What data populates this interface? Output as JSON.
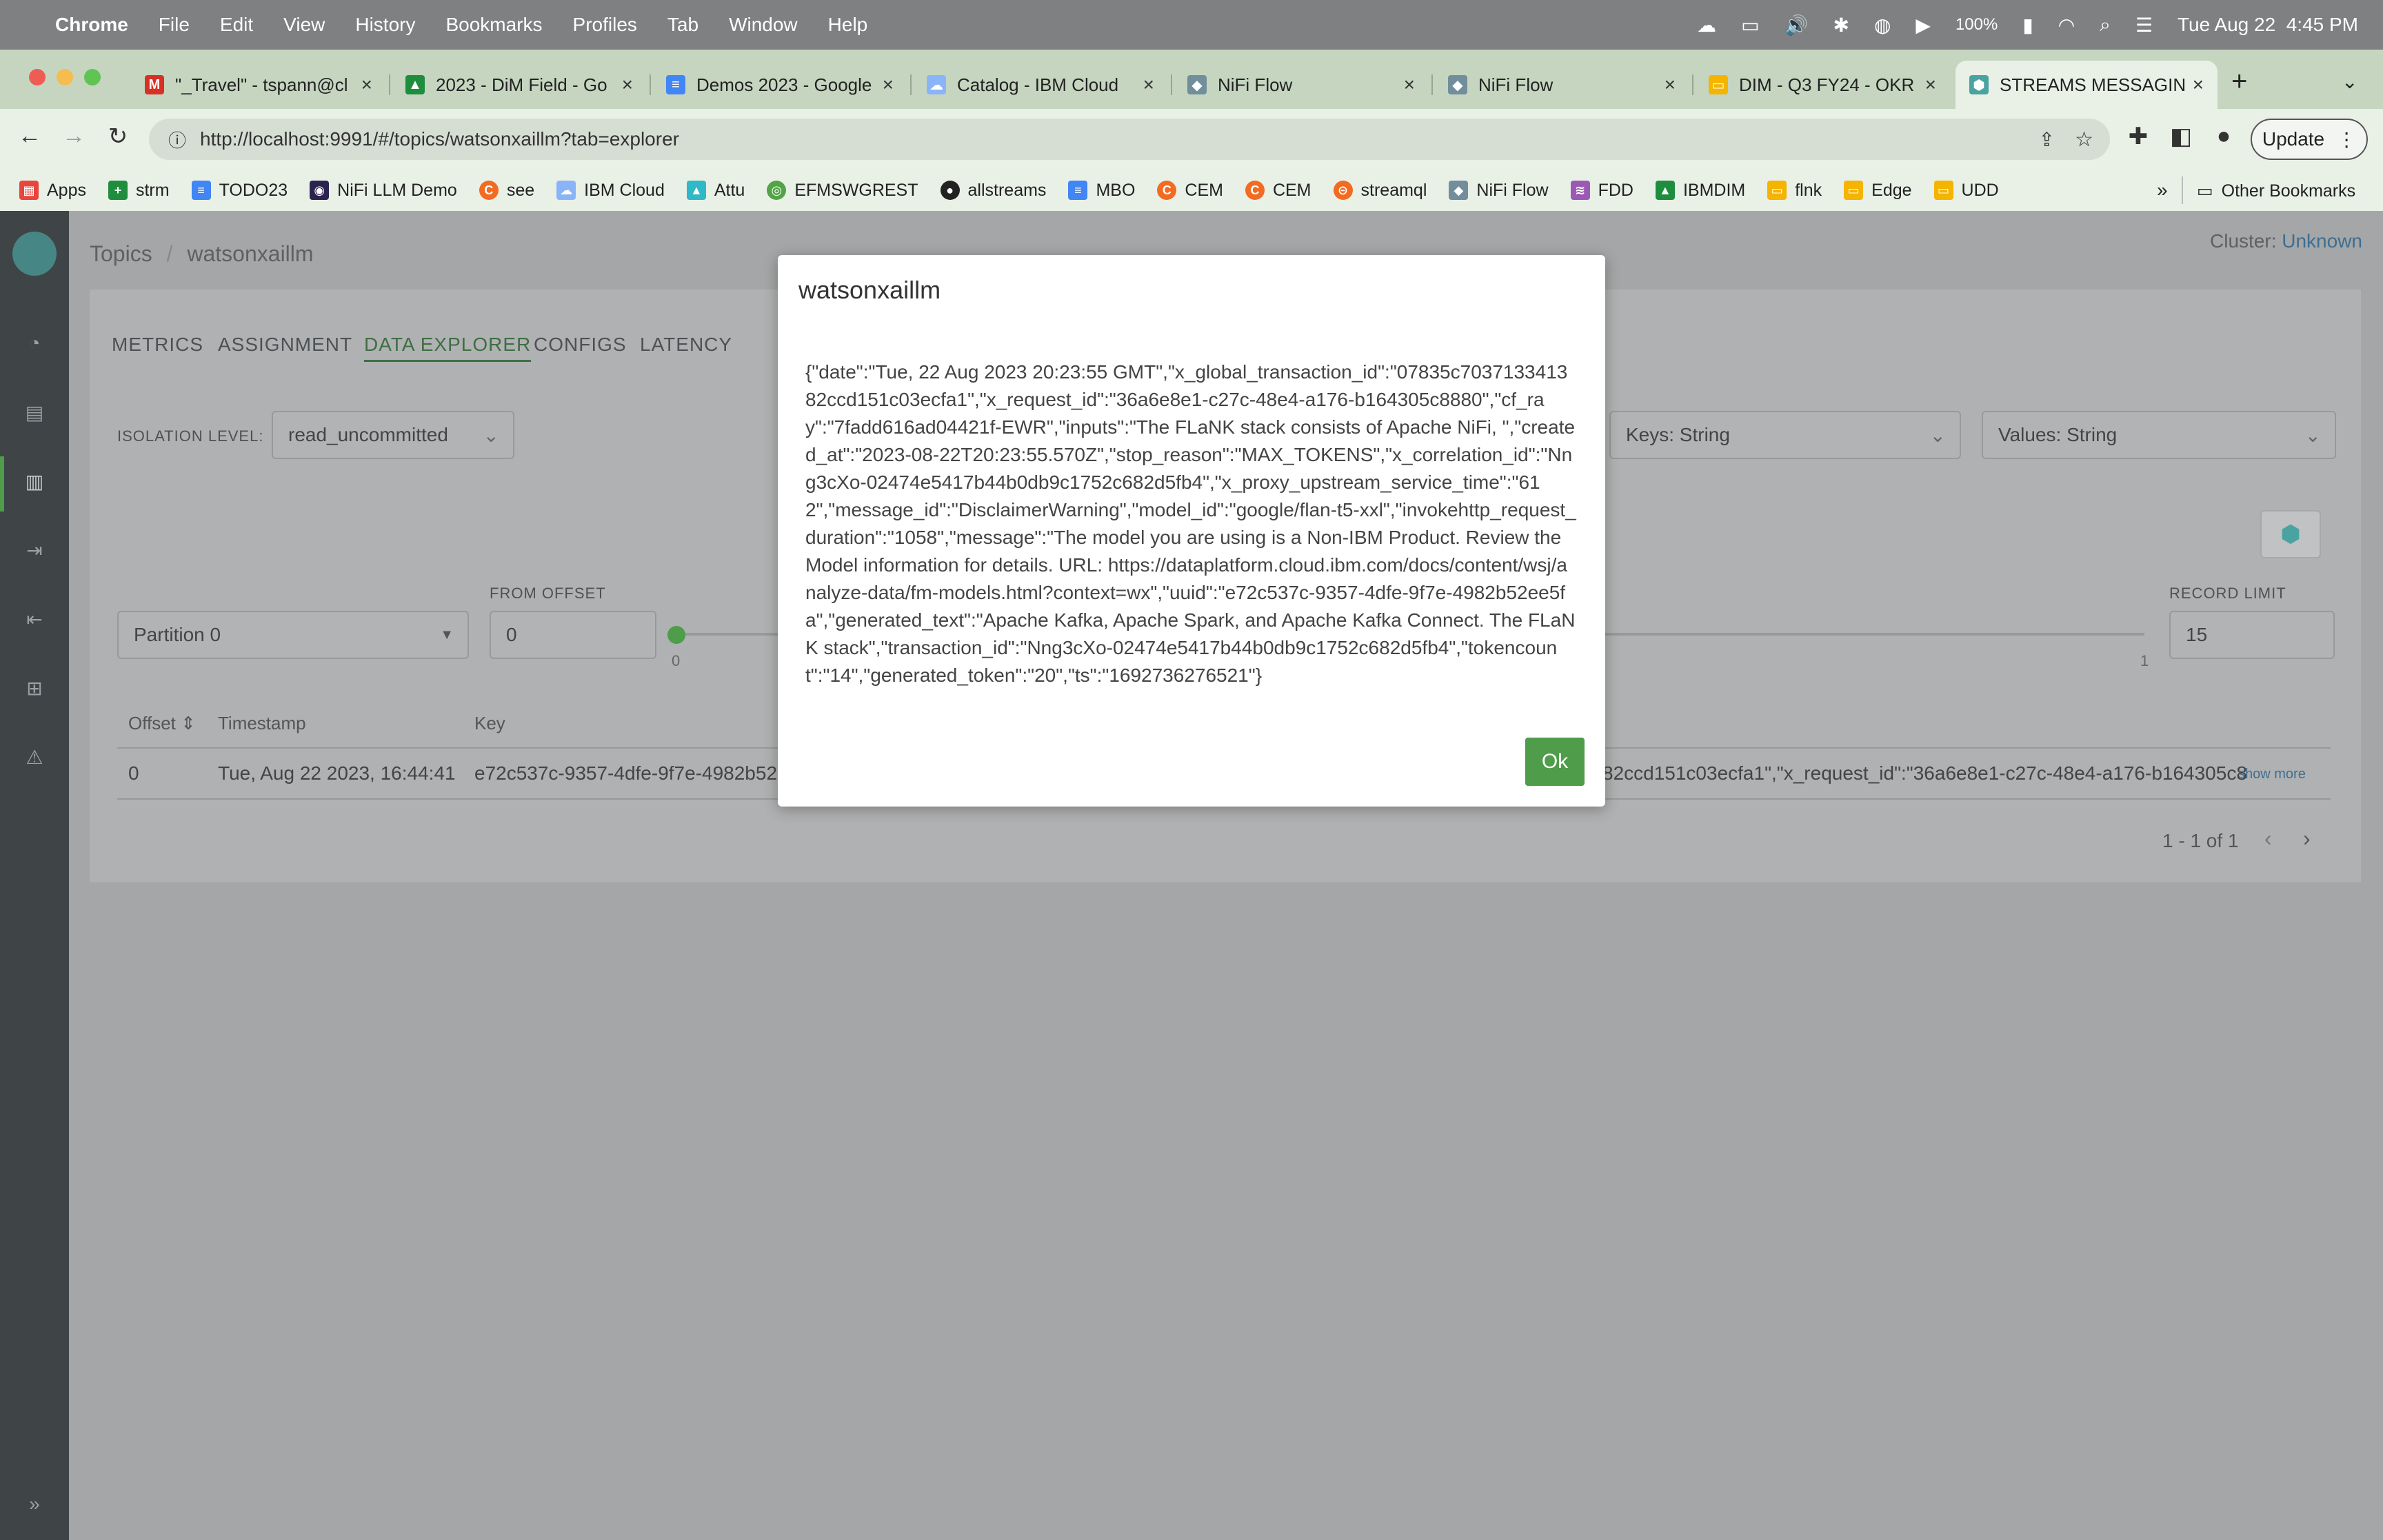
{
  "menubar": {
    "app": "Chrome",
    "items": [
      "File",
      "Edit",
      "View",
      "History",
      "Bookmarks",
      "Profiles",
      "Tab",
      "Window",
      "Help"
    ],
    "battery": "100%",
    "datetime": "Tue Aug 22  4:45 PM"
  },
  "tabs": [
    {
      "label": "\"_Travel\" - tspann@cl",
      "icon": "gmail-icon",
      "color": "#d93025"
    },
    {
      "label": "2023 - DiM Field - Go",
      "icon": "drive-icon",
      "color": "#1e8e3e"
    },
    {
      "label": "Demos 2023 - Google",
      "icon": "docs-icon",
      "color": "#4285f4"
    },
    {
      "label": "Catalog - IBM Cloud",
      "icon": "cloud-icon",
      "color": "#8ab4f8"
    },
    {
      "label": "NiFi Flow",
      "icon": "nifi-icon",
      "color": "#728e9b"
    },
    {
      "label": "NiFi Flow",
      "icon": "nifi-icon",
      "color": "#728e9b"
    },
    {
      "label": "DIM - Q3 FY24 - OKR",
      "icon": "slides-icon",
      "color": "#f4b400"
    },
    {
      "label": "STREAMS MESSAGING",
      "icon": "smm-icon",
      "color": "#4aa3a0"
    }
  ],
  "toolbar": {
    "url": "http://localhost:9991/#/topics/watsonxaillm?tab=explorer",
    "update_label": "Update"
  },
  "bookmarks": [
    {
      "label": "Apps",
      "color": "#e8453c"
    },
    {
      "label": "strm",
      "color": "#1e8e3e"
    },
    {
      "label": "TODO23",
      "color": "#4285f4"
    },
    {
      "label": "NiFi LLM Demo",
      "color": "#2a2350"
    },
    {
      "label": "see",
      "color": "#f26b21"
    },
    {
      "label": "IBM Cloud",
      "color": "#8ab4f8"
    },
    {
      "label": "Attu",
      "color": "#2fb8c7"
    },
    {
      "label": "EFMSWGREST",
      "color": "#52a447"
    },
    {
      "label": "allstreams",
      "color": "#222222"
    },
    {
      "label": "MBO",
      "color": "#4285f4"
    },
    {
      "label": "CEM",
      "color": "#f26b21"
    },
    {
      "label": "CEM",
      "color": "#f26b21"
    },
    {
      "label": "streamql",
      "color": "#f26b21"
    },
    {
      "label": "NiFi Flow",
      "color": "#728e9b"
    },
    {
      "label": "FDD",
      "color": "#9b59b6"
    },
    {
      "label": "IBMDIM",
      "color": "#1e8e3e"
    },
    {
      "label": "flnk",
      "color": "#f4b400"
    },
    {
      "label": "Edge",
      "color": "#f4b400"
    },
    {
      "label": "UDD",
      "color": "#f4b400"
    }
  ],
  "bookmarks_more": "»",
  "other_bookmarks": "Other Bookmarks",
  "app": {
    "breadcrumb_root": "Topics",
    "breadcrumb_sep": "/",
    "breadcrumb_topic": "watsonxaillm",
    "cluster_label": "Cluster:",
    "cluster_value": "Unknown",
    "tabs": [
      "METRICS",
      "ASSIGNMENT",
      "DATA EXPLORER",
      "CONFIGS",
      "LATENCY"
    ],
    "isolation_label": "ISOLATION LEVEL:",
    "isolation_value": "read_uncommitted",
    "keys_value": "Keys: String",
    "values_value": "Values: String",
    "from_offset_label": "FROM OFFSET",
    "from_offset_value": "0",
    "partition_value": "Partition 0",
    "record_limit_label": "RECORD LIMIT",
    "record_limit_value": "15",
    "slider_min": "0",
    "slider_max": "1",
    "columns": [
      "Offset",
      "Timestamp",
      "Key"
    ],
    "row": {
      "offset": "0",
      "timestamp": "Tue, Aug 22 2023, 16:44:41",
      "key": "e72c537c-9357-4dfe-9f7e-4982b52",
      "value_tail": "82ccd151c03ecfa1\",\"x_request_id\":\"36a6e8e1-c27c-48e4-a176-b164305c8",
      "show_more": "show more"
    },
    "pagination": "1 - 1 of 1"
  },
  "modal": {
    "title": "watsonxaillm",
    "body": "{\"date\":\"Tue, 22 Aug 2023 20:23:55 GMT\",\"x_global_transaction_id\":\"07835c703713341382ccd151c03ecfa1\",\"x_request_id\":\"36a6e8e1-c27c-48e4-a176-b164305c8880\",\"cf_ray\":\"7fadd616ad04421f-EWR\",\"inputs\":\"The FLaNK stack consists of Apache NiFi, \",\"created_at\":\"2023-08-22T20:23:55.570Z\",\"stop_reason\":\"MAX_TOKENS\",\"x_correlation_id\":\"Nng3cXo-02474e5417b44b0db9c1752c682d5fb4\",\"x_proxy_upstream_service_time\":\"612\",\"message_id\":\"DisclaimerWarning\",\"model_id\":\"google/flan-t5-xxl\",\"invokehttp_request_duration\":\"1058\",\"message\":\"The model you are using is a Non-IBM Product. Review the Model information for details. URL: https://dataplatform.cloud.ibm.com/docs/content/wsj/analyze-data/fm-models.html?context=wx\",\"uuid\":\"e72c537c-9357-4dfe-9f7e-4982b52ee5fa\",\"generated_text\":\"Apache Kafka, Apache Spark, and Apache Kafka Connect. The FLaNK stack\",\"transaction_id\":\"Nng3cXo-02474e5417b44b0db9c1752c682d5fb4\",\"tokencount\":\"14\",\"generated_token\":\"20\",\"ts\":\"1692736276521\"}",
    "ok_label": "Ok"
  }
}
